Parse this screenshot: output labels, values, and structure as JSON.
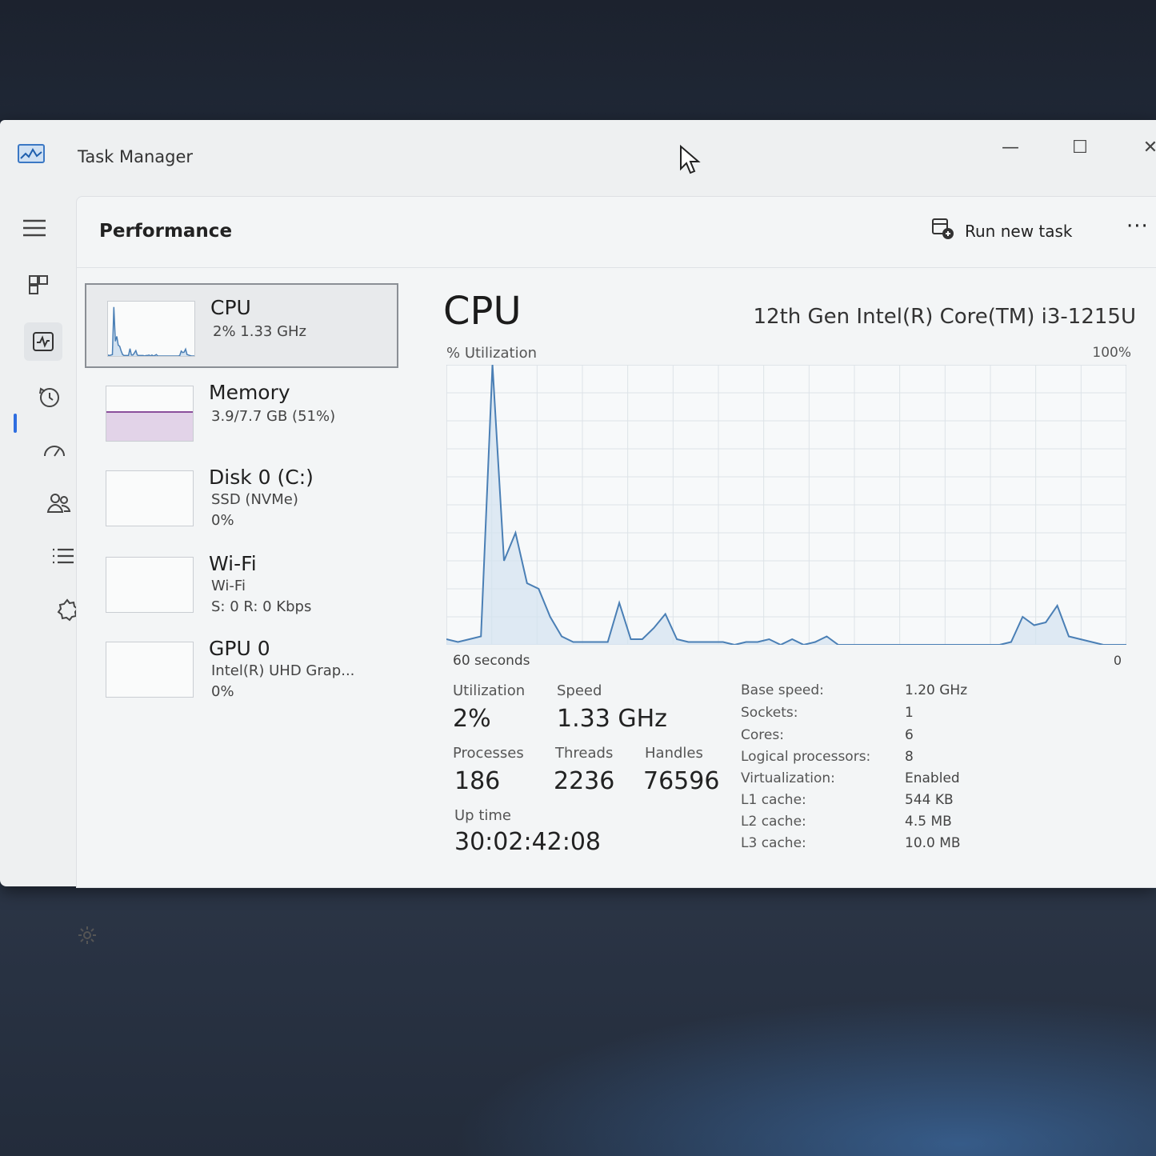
{
  "window": {
    "title": "Task Manager",
    "minimize": "—",
    "maximize": "☐",
    "close": "✕"
  },
  "header": {
    "title": "Performance",
    "run_task": "Run new task",
    "more": "···"
  },
  "devices": [
    {
      "name": "CPU",
      "line1": "2%  1.33 GHz",
      "line2": ""
    },
    {
      "name": "Memory",
      "line1": "3.9/7.7 GB (51%)",
      "line2": ""
    },
    {
      "name": "Disk 0 (C:)",
      "line1": "SSD (NVMe)",
      "line2": "0%"
    },
    {
      "name": "Wi-Fi",
      "line1": "Wi-Fi",
      "line2": "S: 0 R: 0 Kbps"
    },
    {
      "name": "GPU 0",
      "line1": "Intel(R) UHD Grap...",
      "line2": "0%"
    }
  ],
  "detail": {
    "title": "CPU",
    "model": "12th Gen Intel(R) Core(TM) i3-1215U",
    "util_label": "% Utilization",
    "max_label": "100%",
    "axis_left": "60 seconds",
    "axis_right": "0",
    "stats": {
      "utilization_label": "Utilization",
      "utilization": "2%",
      "speed_label": "Speed",
      "speed": "1.33 GHz",
      "processes_label": "Processes",
      "processes": "186",
      "threads_label": "Threads",
      "threads": "2236",
      "handles_label": "Handles",
      "handles": "76596",
      "uptime_label": "Up time",
      "uptime": "30:02:42:08"
    },
    "info": [
      {
        "key": "Base speed:",
        "value": "1.20 GHz"
      },
      {
        "key": "Sockets:",
        "value": "1"
      },
      {
        "key": "Cores:",
        "value": "6"
      },
      {
        "key": "Logical processors:",
        "value": "8"
      },
      {
        "key": "Virtualization:",
        "value": "Enabled"
      },
      {
        "key": "L1 cache:",
        "value": "544 KB"
      },
      {
        "key": "L2 cache:",
        "value": "4.5 MB"
      },
      {
        "key": "L3 cache:",
        "value": "10.0 MB"
      }
    ]
  },
  "chart_data": {
    "type": "line",
    "ylim": [
      0,
      100
    ],
    "xlim": [
      60,
      0
    ],
    "series": [
      {
        "values": [
          2,
          1,
          2,
          3,
          100,
          30,
          40,
          22,
          20,
          10,
          3,
          1,
          1,
          1,
          1,
          15,
          2,
          2,
          6,
          11,
          2,
          1,
          1,
          1,
          1,
          0,
          1,
          1,
          2,
          0,
          2,
          0,
          1,
          3,
          0,
          0,
          0,
          0,
          0,
          0,
          0,
          0,
          0,
          0,
          0,
          0,
          0,
          0,
          0,
          1,
          10,
          7,
          8,
          14,
          3,
          2,
          1,
          0,
          0,
          0
        ]
      }
    ]
  },
  "colors": {
    "accent": "#2f6ee0",
    "cpu_line": "#4a7fb5",
    "cpu_fill": "#d3e2f0",
    "mem_line": "#8b4f9c",
    "disk_line": "#5a9b3c",
    "wifi_line": "#b86a2a",
    "gpu_line": "#3f8fc6"
  },
  "icons": {
    "app": "task-manager-icon",
    "hamburger": "hamburger-icon",
    "processes": "processes-icon",
    "performance": "performance-icon",
    "history": "app-history-icon",
    "startup": "startup-apps-icon",
    "users": "users-icon",
    "details": "details-icon",
    "services": "services-icon",
    "settings": "settings-icon",
    "run": "run-task-icon"
  }
}
